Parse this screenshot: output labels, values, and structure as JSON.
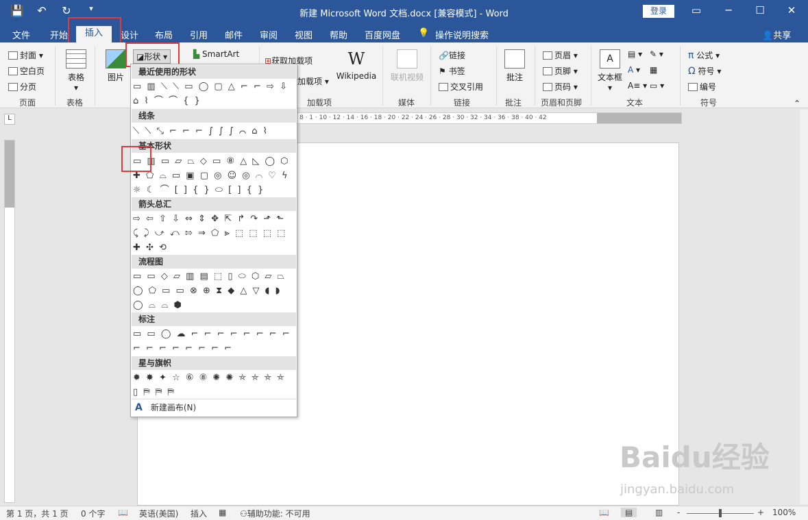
{
  "window": {
    "title": "新建 Microsoft Word 文档.docx [兼容模式]  -  Word",
    "login": "登录",
    "qat": {
      "save": "💾",
      "undo": "↶",
      "redo": "↻",
      "customize": "▾"
    },
    "controls": {
      "ribbon_display": "▭",
      "minimize": "─",
      "maximize": "☐",
      "close": "✕"
    }
  },
  "tabs": [
    "文件",
    "开始",
    "插入",
    "设计",
    "布局",
    "引用",
    "邮件",
    "审阅",
    "视图",
    "帮助",
    "百度网盘",
    "操作说明搜索"
  ],
  "tab_active": "插入",
  "share": "共享",
  "ribbon": {
    "pages": {
      "cover": "封面",
      "blank": "空白页",
      "break": "分页",
      "label": "页面"
    },
    "table": {
      "button": "表格",
      "label": "表格"
    },
    "picture": {
      "button": "图片"
    },
    "shapes": {
      "button": "形状"
    },
    "smartart": "SmartArt",
    "addins": {
      "get": "获取加载项",
      "my": "加载项",
      "wiki": "Wikipedia",
      "label": "加载项"
    },
    "media": {
      "video": "联机视频",
      "label": "媒体"
    },
    "links": {
      "link": "链接",
      "bookmark": "书签",
      "crossref": "交叉引用",
      "label": "链接"
    },
    "comments": {
      "comment": "批注",
      "label": "批注"
    },
    "headerfooter": {
      "header": "页眉",
      "footer": "页脚",
      "pagenum": "页码",
      "label": "页眉和页脚"
    },
    "text": {
      "textbox": "文本框",
      "label": "文本"
    },
    "symbols": {
      "equation": "公式",
      "symbol": "符号",
      "numbering": "编号",
      "label": "符号"
    }
  },
  "shapes_menu": {
    "sections": [
      {
        "title": "最近使用的形状",
        "rows": [
          "▭ ▥ ⟍ ⟍ ▭ ◯ ▢ △ ⌐ ⌐ ⇨ ⇩",
          "⌂ ⌇ ⌒ ⌒ { }"
        ]
      },
      {
        "title": "线条",
        "rows": [
          "⟍ ⟍ ⤡ ⌐ ⌐ ⌐ ∫ ∫ ∫ ⌒ ⌂ ⌇"
        ]
      },
      {
        "title": "基本形状",
        "rows": [
          "▭ ▥ ▭ ▱ ⏢ ◇ ▭ ⑧ △ ◺ ◯ ⬡",
          "✚ ⬠ ⌓ ▭ ▣ ▢ ◎ ☺ ◎ ⌒ ♡ ϟ",
          "☼ ☾ ⌒ [ ] { } ⬭ [ ] { }"
        ]
      },
      {
        "title": "箭头总汇",
        "rows": [
          "⇨ ⇦ ⇧ ⇩ ⇔ ⇕ ✥ ⇱ ↱ ↷ ⬏ ⬑",
          "⤹ ⤸ ⤻ ⤺ ⇰ ⇒ ⬠ ⪢ ⬚ ⬚ ⬚ ⬚",
          "✚ ✣ ⟲"
        ]
      },
      {
        "title": "流程图",
        "rows": [
          "▭ ▭ ◇ ▱ ▥ ▤ ⬚ ▯ ⬭ ⬡ ⏥ ⏢",
          "◯ ⬠ ▭ ▭ ⊗ ⊕ ⧗ ◆ △ ▽ ◖ ◗",
          "◯ ⌓ ⌓ ⬢"
        ]
      },
      {
        "title": "标注",
        "rows": [
          "▭ ▭ ◯ ☁ ⌐ ⌐ ⌐ ⌐ ⌐ ⌐ ⌐ ⌐",
          "⌐ ⌐ ⌐ ⌐ ⌐ ⌐ ⌐ ⌐"
        ]
      },
      {
        "title": "星与旗帜",
        "rows": [
          "✹ ✸ ✦ ☆ ⑥ ⑧ ✺ ✺ ⛤ ⛤ ⛤ ⛤",
          "▯ ⛿ ⛿ ⛿"
        ]
      }
    ],
    "new_canvas": "新建画布(N)",
    "new_canvas_icon": "A"
  },
  "ruler": {
    "h_ticks": "8 · 1 · 10 · 12 · 14 · 16 · 18 · 20 · 22 · 24 · 26 · 28 · 30 · 32 · 34 · 36 · 38 · 40 · 42",
    "corner": "L"
  },
  "status": {
    "page": "第 1 页，共 1 页",
    "words": "0 个字",
    "lang": "英语(美国)",
    "mode": "插入",
    "accessibility": "辅助功能: 不可用",
    "zoom": "100%",
    "minus": "-",
    "plus": "+"
  },
  "watermark": {
    "main": "Baidu经验",
    "url": "jingyan.baidu.com"
  }
}
